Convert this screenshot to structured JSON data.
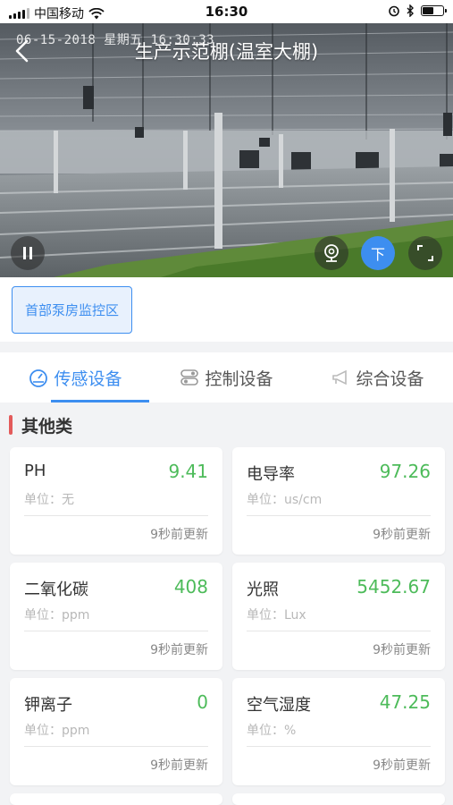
{
  "status_bar": {
    "carrier": "中国移动",
    "time": "16:30"
  },
  "video": {
    "title": "生产示范棚(温室大棚)",
    "osd_text": "06-15-2018  星期五  16:30:33",
    "controls": {
      "pause_icon": "pause-icon",
      "camera_icon": "webcam-icon",
      "ptz_button_label": "下",
      "fullscreen_icon": "fullscreen-icon"
    }
  },
  "area": {
    "chip_label": "首部泵房监控区"
  },
  "tabs": [
    {
      "label": "传感设备",
      "icon": "gauge-icon",
      "active": true
    },
    {
      "label": "控制设备",
      "icon": "switch-icon",
      "active": false
    },
    {
      "label": "综合设备",
      "icon": "megaphone-icon",
      "active": false
    }
  ],
  "category": {
    "label": "其他类",
    "accent_color": "#e35a5a"
  },
  "sensors": [
    {
      "name": "PH",
      "value": "9.41",
      "unit": "单位：无",
      "updated": "9秒前更新"
    },
    {
      "name": "电导率",
      "value": "97.26",
      "unit": "单位：us/cm",
      "updated": "9秒前更新"
    },
    {
      "name": "二氧化碳",
      "value": "408",
      "unit": "单位：ppm",
      "updated": "9秒前更新"
    },
    {
      "name": "光照",
      "value": "5452.67",
      "unit": "单位：Lux",
      "updated": "9秒前更新"
    },
    {
      "name": "钾离子",
      "value": "0",
      "unit": "单位：ppm",
      "updated": "9秒前更新"
    },
    {
      "name": "空气湿度",
      "value": "47.25",
      "unit": "单位：%",
      "updated": "9秒前更新"
    }
  ],
  "colors": {
    "accent": "#3d8ef0",
    "value_green": "#4dbb5a"
  }
}
